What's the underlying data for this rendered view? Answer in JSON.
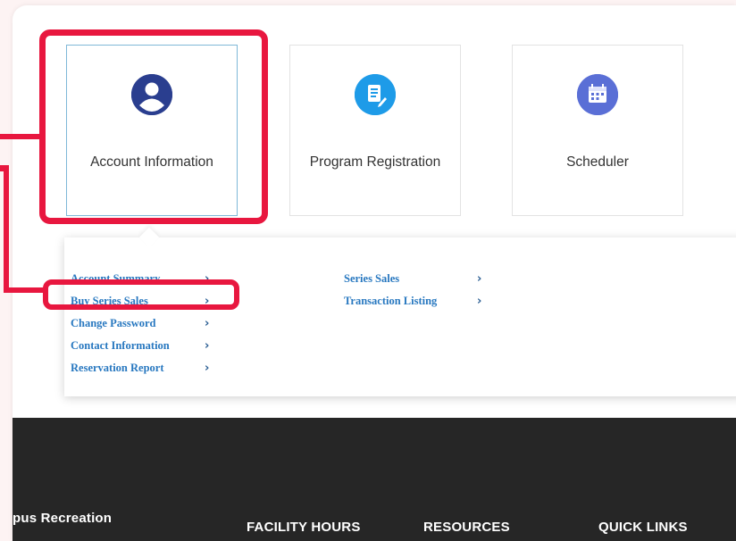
{
  "tiles": [
    {
      "label": "Account Information",
      "icon": "user-icon",
      "color": "#2a3e8f"
    },
    {
      "label": "Program Registration",
      "icon": "document-edit-icon",
      "color": "#1e9be8"
    },
    {
      "label": "Scheduler",
      "icon": "calendar-icon",
      "color": "#5a6fd6"
    }
  ],
  "dropdown": {
    "left_column": [
      {
        "label": "Account Summary"
      },
      {
        "label": "Buy Series Sales"
      },
      {
        "label": "Change Password"
      },
      {
        "label": "Contact Information"
      },
      {
        "label": "Reservation Report"
      }
    ],
    "right_column": [
      {
        "label": "Series Sales"
      },
      {
        "label": "Transaction Listing"
      }
    ]
  },
  "footer": {
    "brand": "pus Recreation",
    "facility_hours": "FACILITY HOURS",
    "resources": "RESOURCES",
    "quick_links": "QUICK LINKS"
  },
  "colors": {
    "highlight": "#e8173f",
    "link": "#2878c0",
    "footer_bg": "#262626"
  }
}
